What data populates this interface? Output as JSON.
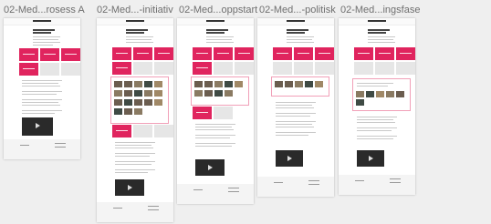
{
  "artboards": [
    {
      "label": "02-Med...rosess A"
    },
    {
      "label": "02-Med...-initiativ"
    },
    {
      "label": "02-Med...oppstart"
    },
    {
      "label": "02-Med...-politisk"
    },
    {
      "label": "02-Med...ingsfase"
    }
  ],
  "colors": {
    "accent": "#e0245e",
    "canvas": "#efefef",
    "artboard": "#ffffff"
  }
}
